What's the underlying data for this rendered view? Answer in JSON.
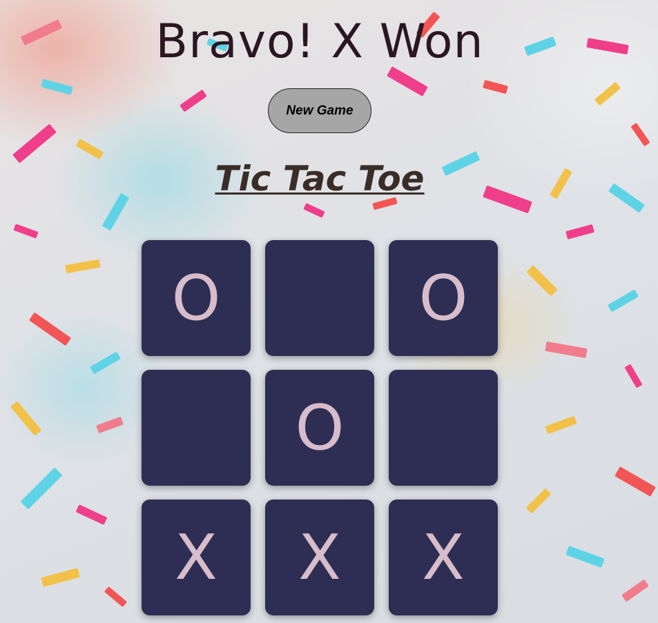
{
  "game": {
    "status": "Bravo! X Won",
    "title": "Tic Tac Toe",
    "new_game_label": "New Game"
  },
  "board": {
    "cells": [
      "O",
      "",
      "O",
      "",
      "O",
      "",
      "X",
      "X",
      "X"
    ]
  },
  "colors": {
    "cell_background": "#2e2e54",
    "mark_color": "#d7bccb",
    "status_color": "#2a1722",
    "title_color": "#3a2d28",
    "button_background": "#a6a6a6"
  }
}
